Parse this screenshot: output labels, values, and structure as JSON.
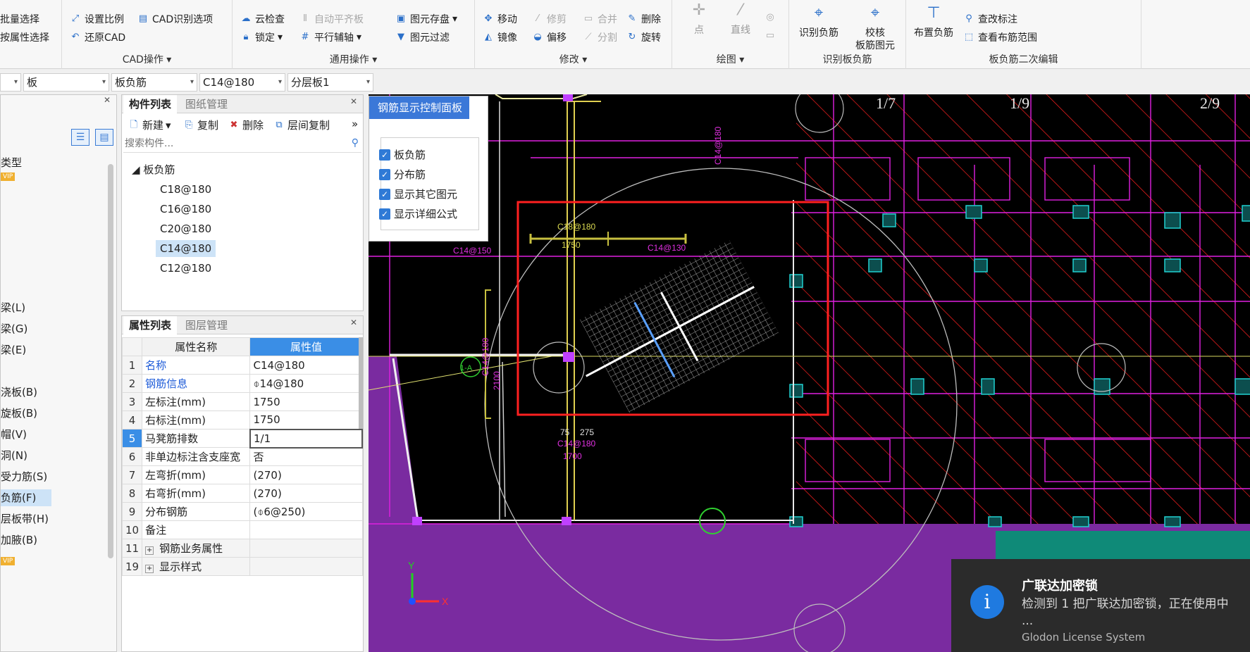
{
  "ribbon": {
    "g1": {
      "items": [
        "批量选择",
        "按属性选择"
      ]
    },
    "cad": {
      "title": "CAD操作",
      "set_scale": "设置比例",
      "restore": "还原CAD",
      "cad_opts": "CAD识别选项"
    },
    "general": {
      "title": "通用操作",
      "cloud_check": "云检查",
      "lock": "锁定",
      "auto_flat": "自动平齐板",
      "parallel": "平行辅轴",
      "elem_save": "图元存盘",
      "elem_filter": "图元过滤"
    },
    "modify": {
      "title": "修改",
      "move": "移动",
      "trim": "修剪",
      "merge": "合并",
      "delete": "删除",
      "mirror": "镜像",
      "offset": "偏移",
      "split": "分割",
      "rotate": "旋转"
    },
    "draw": {
      "title": "绘图",
      "point": "点",
      "line": "直线"
    },
    "recog": {
      "title": "识别板负筋",
      "identify": "识别负筋",
      "verify": "校核\n板筋图元"
    },
    "edit2": {
      "title": "板负筋二次编辑",
      "place": "布置负筋",
      "check_mark": "查改标注",
      "view_range": "查看布筋范围"
    }
  },
  "combos": [
    "板",
    "板负筋",
    "C14@180",
    "分层板1"
  ],
  "left_panel": {
    "items": [
      "类型",
      "梁(L)",
      "梁(G)",
      "梁(E)",
      "浇板(B)",
      "旋板(B)",
      "帽(V)",
      "洞(N)",
      "受力筋(S)",
      "负筋(F)",
      "层板带(H)",
      "加腋(B)"
    ],
    "vip": "VIP"
  },
  "component_list": {
    "tab_active": "构件列表",
    "tab_inactive": "图纸管理",
    "new": "新建",
    "copy": "复制",
    "delete": "删除",
    "layer_copy": "层间复制",
    "search_placeholder": "搜索构件...",
    "root": "板负筋",
    "items": [
      "C18@180",
      "C16@180",
      "C20@180",
      "C14@180",
      "C12@180"
    ],
    "selected_index": 3
  },
  "properties": {
    "tab_active": "属性列表",
    "tab_inactive": "图层管理",
    "col_name": "属性名称",
    "col_value": "属性值",
    "rows": [
      {
        "n": "1",
        "name": "名称",
        "value": "C14@180",
        "blue": true
      },
      {
        "n": "2",
        "name": "钢筋信息",
        "value": "⌽14@180",
        "blue": true
      },
      {
        "n": "3",
        "name": "左标注(mm)",
        "value": "1750"
      },
      {
        "n": "4",
        "name": "右标注(mm)",
        "value": "1750"
      },
      {
        "n": "5",
        "name": "马凳筋排数",
        "value": "1/1"
      },
      {
        "n": "6",
        "name": "非单边标注含支座宽",
        "value": "否"
      },
      {
        "n": "7",
        "name": "左弯折(mm)",
        "value": "(270)"
      },
      {
        "n": "8",
        "name": "右弯折(mm)",
        "value": "(270)"
      },
      {
        "n": "9",
        "name": "分布钢筋",
        "value": "(⌽6@250)"
      },
      {
        "n": "10",
        "name": "备注",
        "value": ""
      },
      {
        "n": "11",
        "name": "钢筋业务属性",
        "value": "",
        "expand": "+"
      },
      {
        "n": "19",
        "name": "显示样式",
        "value": "",
        "expand": "+"
      }
    ]
  },
  "control_panel": {
    "title": "钢筋显示控制面板",
    "options": [
      "板负筋",
      "分布筋",
      "显示其它图元",
      "显示详细公式"
    ]
  },
  "canvas": {
    "labels": {
      "c18": "C18@180",
      "c1750": "1750",
      "c14a": "C14@150",
      "c14b": "C14@130",
      "c14c": "C14@180",
      "c1700": "1700",
      "c14d": "C14@180",
      "dim1": "75",
      "dim2": "275",
      "ax1": "1/7",
      "ax2": "1/9",
      "ax3": "2/9",
      "mark1": "1-A",
      "c14e": "C14@180",
      "dim3": "2100",
      "axis_x": "X",
      "axis_y": "Y"
    }
  },
  "toast": {
    "title": "广联达加密锁",
    "body": "检测到 1 把广联达加密锁，正在使用中 ...",
    "footer": "Glodon License System",
    "icon": "i"
  }
}
